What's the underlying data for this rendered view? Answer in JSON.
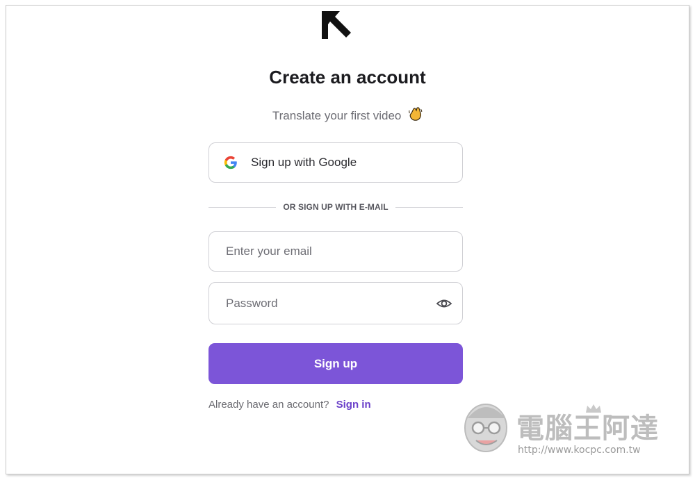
{
  "title": "Create an account",
  "subtitle": "Translate your first video",
  "google_button": {
    "label": "Sign up with Google"
  },
  "divider_text": "OR SIGN UP WITH E-MAIL",
  "email": {
    "placeholder": "Enter your email",
    "value": ""
  },
  "password": {
    "placeholder": "Password",
    "value": ""
  },
  "signup_button": {
    "label": "Sign up"
  },
  "signin": {
    "prompt": "Already have an account?",
    "link": "Sign in"
  },
  "watermark": {
    "name": "電腦王阿達",
    "url": "http://www.kocpc.com.tw"
  },
  "colors": {
    "accent": "#7c55d8",
    "link": "#6a3fc9",
    "border": "#cfcfd4"
  }
}
